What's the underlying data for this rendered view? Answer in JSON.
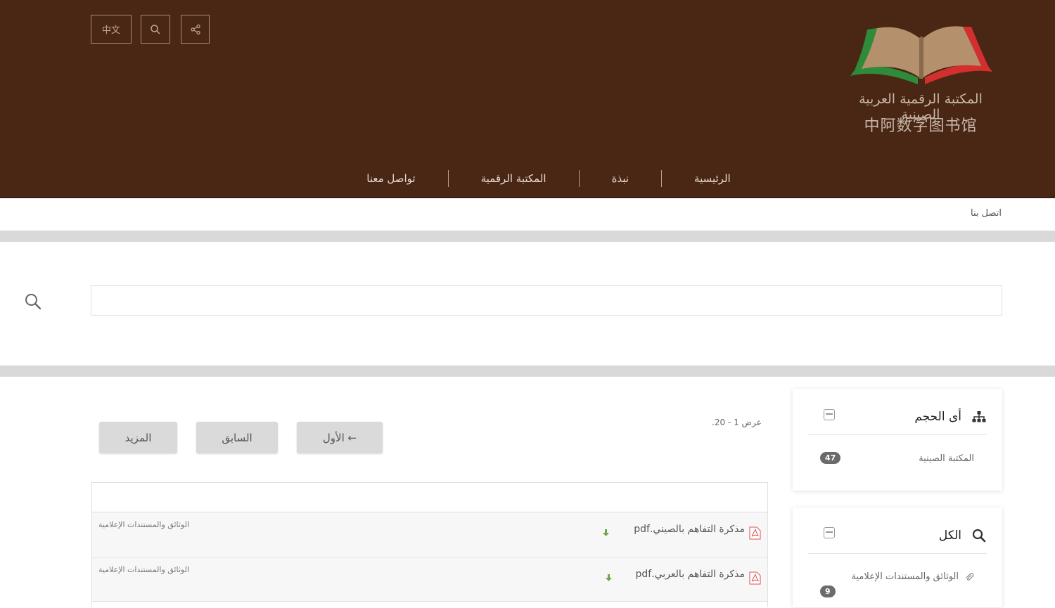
{
  "header": {
    "lang_button": "中文",
    "search_button_icon": "search-icon",
    "share_button_icon": "share-icon",
    "logo_ar": "المكتبة الرقمية العربية الصينية",
    "logo_cn": "中阿数字图书馆"
  },
  "nav": {
    "items": [
      "الرئيسية",
      "نبذة",
      "المكتبة الرقمية",
      "تواصل معنا"
    ]
  },
  "breadcrumb": "اتصل بنا",
  "search": {
    "value": "",
    "placeholder": ""
  },
  "facets": {
    "size": {
      "title": "أى الحجم",
      "icon": "sitemap-icon",
      "items": [
        {
          "label": "المكتبة الصينية",
          "count": "47"
        }
      ]
    },
    "all": {
      "title": "الكل",
      "icon": "search-icon",
      "items": [
        {
          "label": "الوثائق والمستندات الإعلامية",
          "count": "9"
        }
      ]
    }
  },
  "results": {
    "showing": "عرض 1 - 20.",
    "pagination": {
      "first": "الأول ←",
      "prev": "السابق",
      "more": "المزيد"
    },
    "items": [
      {
        "title": "مذكرة التفاهم بالصيني.pdf",
        "category": "الوثائق والمستندات الإعلامية"
      },
      {
        "title": "مذكرة التفاهم بالعربي.pdf",
        "category": "الوثائق والمستندات الإعلامية"
      }
    ]
  },
  "colors": {
    "header_bg": "#4a2614",
    "logo_green": "#2e8b3a",
    "logo_red": "#d32f2f",
    "logo_book": "#b4906c",
    "band": "#d9d9d9",
    "pdf_red": "#d9534f",
    "download_green": "#6aa84f"
  }
}
